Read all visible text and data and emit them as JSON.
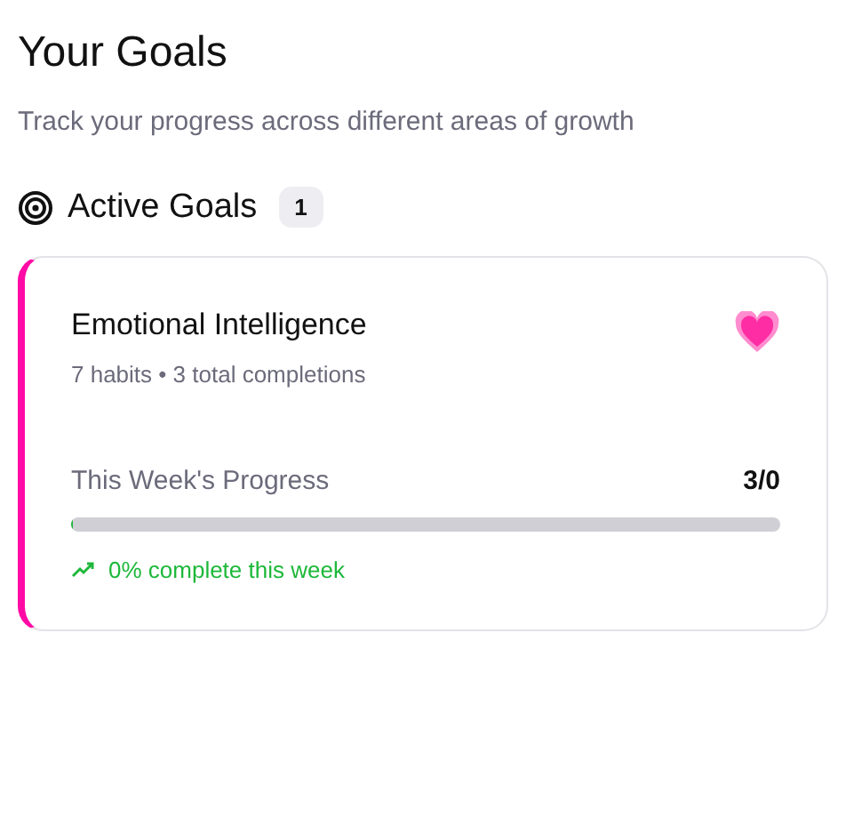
{
  "header": {
    "title": "Your Goals",
    "subtitle": "Track your progress across different areas of growth"
  },
  "section": {
    "title": "Active Goals",
    "count": "1"
  },
  "goals": [
    {
      "name": "Emotional Intelligence",
      "meta": "7 habits • 3 total completions",
      "color": "#ff0aa5",
      "progress_label": "This Week's Progress",
      "progress_value": "3/0",
      "level": 0,
      "trend": "0% complete this week"
    }
  ]
}
